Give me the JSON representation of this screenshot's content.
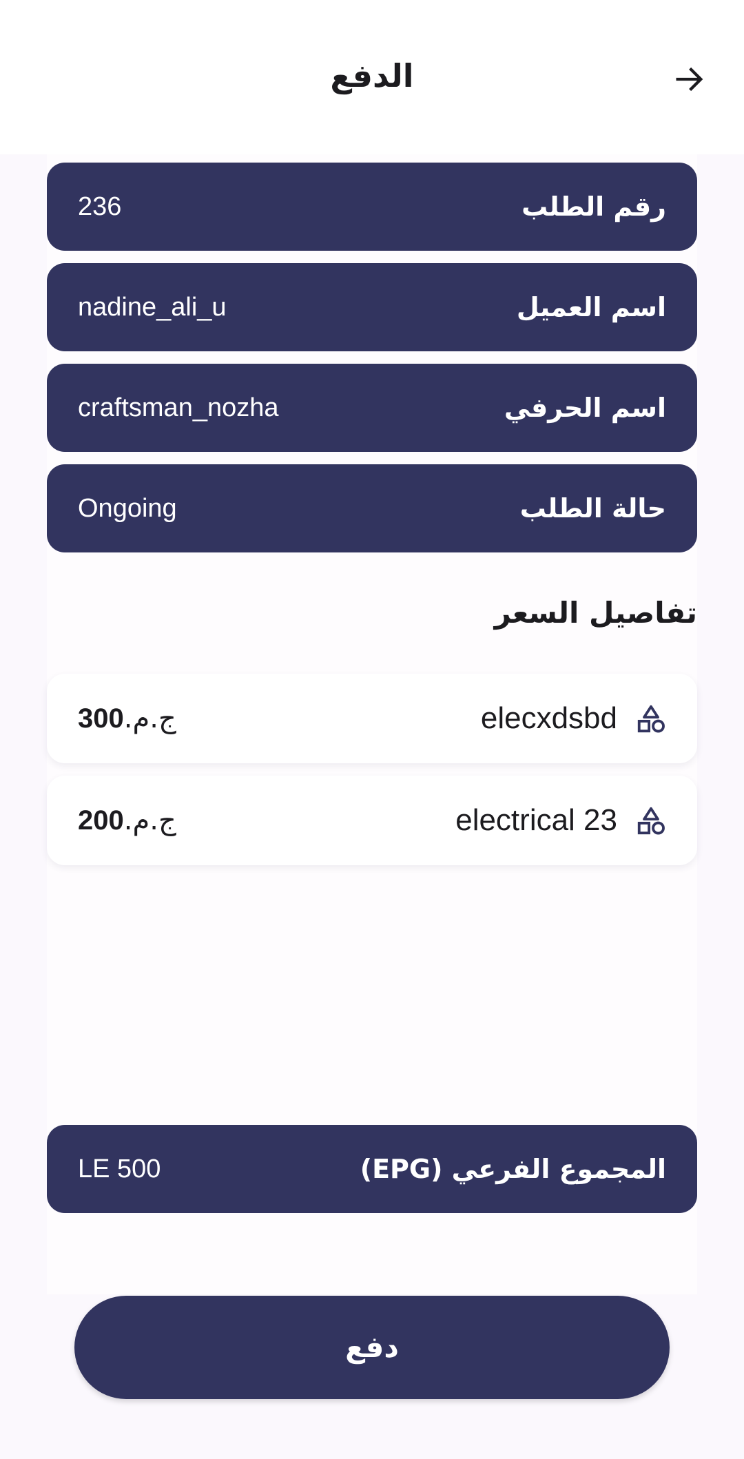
{
  "header": {
    "title": "الدفع",
    "back_icon": "arrow-forward-icon"
  },
  "order_info": [
    {
      "label": "رقم الطلب",
      "value": "236"
    },
    {
      "label": "اسم العميل",
      "value": "nadine_ali_u"
    },
    {
      "label": "اسم الحرفي",
      "value": "craftsman_nozha"
    },
    {
      "label": "حالة الطلب",
      "value": "Ongoing"
    }
  ],
  "price_details": {
    "title": "تفاصيل السعر",
    "items": [
      {
        "icon": "category-shapes-icon",
        "name": "elecxdsbd",
        "amount": "300",
        "currency": "ج.م."
      },
      {
        "icon": "category-shapes-icon",
        "name": "electrical 23",
        "amount": "200",
        "currency": "ج.م."
      }
    ]
  },
  "subtotal": {
    "label": "المجموع الفرعي (EPG)",
    "value": "LE 500"
  },
  "pay_button": {
    "label": "دفع"
  },
  "colors": {
    "primary": "#32345f",
    "background": "#fbf8fd",
    "card": "#ffffff"
  }
}
